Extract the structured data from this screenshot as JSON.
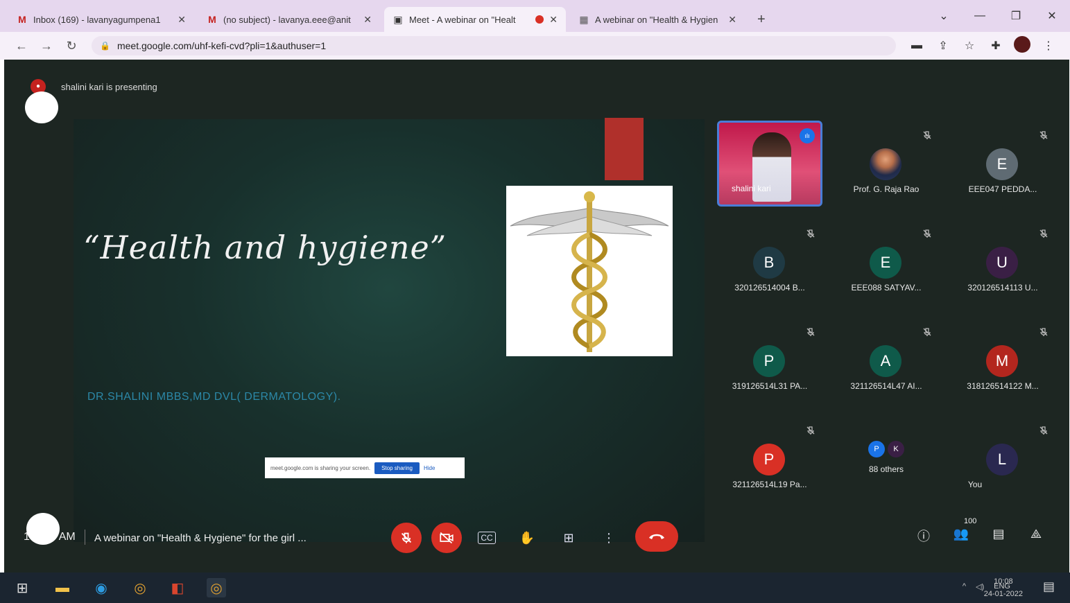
{
  "browser": {
    "tabs": [
      {
        "title": "Inbox (169) - lavanyagumpena1",
        "icon": "gmail-icon"
      },
      {
        "title": "(no subject) - lavanya.eee@anit",
        "icon": "gmail-icon"
      },
      {
        "title": "Meet - A webinar on \"Healt",
        "icon": "meet-icon",
        "active": true,
        "recording": true
      },
      {
        "title": "A webinar on \"Health & Hygien",
        "icon": "calendar-icon"
      }
    ],
    "url": "meet.google.com/uhf-kefi-cvd?pli=1&authuser=1"
  },
  "meet": {
    "presenting_text": "shalini kari is presenting",
    "slide": {
      "title": "“Health and hygiene”",
      "author": "DR.SHALINI MBBS,MD DVL( DERMATOLOGY)."
    },
    "share_bar": {
      "text": "meet.google.com is sharing your screen.",
      "stop_label": "Stop sharing",
      "hide_label": "Hide"
    },
    "participants": [
      {
        "name": "shalini kari",
        "type": "video"
      },
      {
        "name": "Prof. G. Raja Rao",
        "type": "photo"
      },
      {
        "name": "EEE047 PEDDA...",
        "initial": "E",
        "color": "#5f6b73"
      },
      {
        "name": "320126514004 B...",
        "initial": "B",
        "color": "#1f3a44"
      },
      {
        "name": "EEE088 SATYAV...",
        "initial": "E",
        "color": "#0f5a4a"
      },
      {
        "name": "320126514113 U...",
        "initial": "U",
        "color": "#3a1f45"
      },
      {
        "name": "319126514L31 PA...",
        "initial": "P",
        "color": "#0f5a4a"
      },
      {
        "name": "321126514L47 AI...",
        "initial": "A",
        "color": "#0f5a4a"
      },
      {
        "name": "318126514122 M...",
        "initial": "M",
        "color": "#b3261e"
      },
      {
        "name": "321126514L19 Pa...",
        "initial": "P",
        "color": "#d93025"
      },
      {
        "name": "88 others",
        "type": "others",
        "dots": [
          "P",
          "K"
        ]
      },
      {
        "name": "You",
        "initial": "L",
        "color": "#2a2850"
      }
    ],
    "bottom": {
      "time": "10:",
      "time_suffix": "AM",
      "meeting_title": "A webinar on \"Health & Hygiene\" for the girl ...",
      "people_count": "100"
    }
  },
  "taskbar": {
    "language": "ENG",
    "time": "10:08",
    "date": "24-01-2022"
  }
}
